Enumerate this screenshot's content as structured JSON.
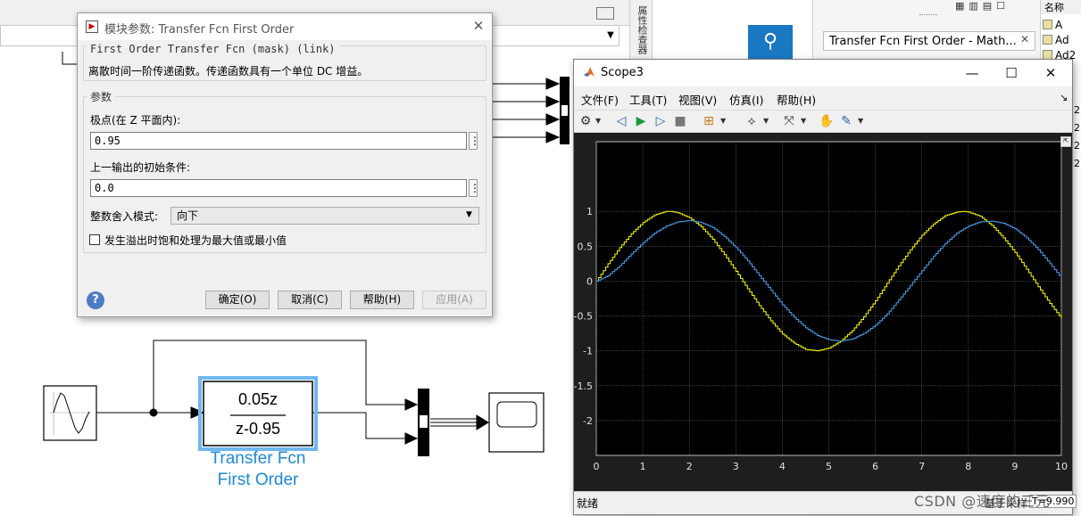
{
  "dialog": {
    "title": "模块参数: Transfer Fcn First Order",
    "mask_group": "First Order Transfer Fcn (mask) (link)",
    "mask_description": "离散时间一阶传递函数。传递函数具有一个单位 DC 增益。",
    "params_group": "参数",
    "pole_label": "极点(在 Z 平面内):",
    "pole_value": "0.95",
    "ic_label": "上一输出的初始条件:",
    "ic_value": "0.0",
    "round_label": "整数舍入模式:",
    "round_value": "向下",
    "saturate_label": "发生溢出时饱和处理为最大值或最小值",
    "saturate_checked": false,
    "buttons": {
      "ok": "确定(O)",
      "cancel": "取消(C)",
      "help": "帮助(H)",
      "apply": "应用(A)"
    },
    "help_icon": "?",
    "dots": "⋮"
  },
  "scope": {
    "title": "Scope3",
    "menu": [
      "文件(F)",
      "工具(T)",
      "视图(V)",
      "仿真(I)",
      "帮助(H)"
    ],
    "status": "就绪",
    "status_sample": "基于采样",
    "status_time": "T=9.990",
    "win_min": "—",
    "win_max": "☐",
    "win_close": "✕",
    "menu_arrow": "↘"
  },
  "side": {
    "property_tab": "属性检查器",
    "doc_tab": "Transfer Fcn First Order - Math...",
    "ws_header": "名称",
    "ws_items": [
      "A",
      "Ad",
      "Ad2"
    ],
    "ws_partial": [
      "2",
      "2",
      "2",
      "2"
    ]
  },
  "model": {
    "tf_numerator": "0.05z",
    "tf_denominator": "z-0.95",
    "tf_label_line1": "Transfer Fcn",
    "tf_label_line2": "First Order"
  },
  "watermark": "CSDN @速度的三元",
  "colors": {
    "input_series": "#ffff00",
    "output_series": "#4aa3ee",
    "tf_highlight": "#1e88d6",
    "plot_bg": "#000000"
  },
  "chart_data": {
    "type": "line",
    "title": "",
    "xlabel": "",
    "ylabel": "",
    "xlim": [
      0,
      10
    ],
    "ylim": [
      -2.5,
      2
    ],
    "xticks": [
      0,
      1,
      2,
      3,
      4,
      5,
      6,
      7,
      8,
      9,
      10
    ],
    "yticks": [
      -2,
      -1.5,
      -1,
      -0.5,
      0,
      0.5,
      1
    ],
    "ytick_labels": [
      "-2",
      "-1.5",
      "-1",
      "-0.5",
      "0",
      "0.5",
      "1"
    ],
    "grid": true,
    "sample_time": 0.05,
    "series": [
      {
        "color": "#ffff00",
        "x": [
          0,
          0.25,
          0.5,
          0.75,
          1.0,
          1.25,
          1.5,
          1.6,
          1.75,
          2.0,
          2.25,
          2.5,
          2.75,
          3.0,
          3.25,
          3.5,
          3.75,
          4.0,
          4.25,
          4.5,
          4.75,
          5.0,
          5.25,
          5.5,
          5.75,
          6.0,
          6.25,
          6.5,
          6.75,
          7.0,
          7.25,
          7.5,
          7.75,
          7.9,
          8.0,
          8.25,
          8.5,
          8.75,
          9.0,
          9.25,
          9.5,
          9.75,
          10.0
        ],
        "y": [
          0,
          0.25,
          0.48,
          0.68,
          0.84,
          0.95,
          1.0,
          1.0,
          0.98,
          0.91,
          0.78,
          0.6,
          0.38,
          0.14,
          -0.11,
          -0.35,
          -0.57,
          -0.76,
          -0.89,
          -0.98,
          -1.0,
          -0.96,
          -0.86,
          -0.71,
          -0.51,
          -0.28,
          -0.03,
          0.22,
          0.45,
          0.66,
          0.82,
          0.94,
          0.99,
          1.0,
          0.99,
          0.93,
          0.8,
          0.62,
          0.41,
          0.17,
          -0.08,
          -0.32,
          -0.54
        ]
      },
      {
        "color": "#4aa3ee",
        "x": [
          0,
          0.25,
          0.5,
          0.75,
          1.0,
          1.25,
          1.5,
          1.75,
          2.0,
          2.25,
          2.5,
          2.75,
          3.0,
          3.25,
          3.5,
          3.75,
          4.0,
          4.25,
          4.5,
          4.75,
          5.0,
          5.25,
          5.5,
          5.75,
          6.0,
          6.25,
          6.5,
          6.75,
          7.0,
          7.25,
          7.5,
          7.75,
          8.0,
          8.25,
          8.5,
          8.75,
          9.0,
          9.25,
          9.5,
          9.75,
          10.0
        ],
        "y": [
          0,
          0.08,
          0.22,
          0.39,
          0.55,
          0.69,
          0.79,
          0.85,
          0.87,
          0.84,
          0.77,
          0.64,
          0.48,
          0.29,
          0.08,
          -0.13,
          -0.34,
          -0.52,
          -0.67,
          -0.78,
          -0.84,
          -0.86,
          -0.83,
          -0.75,
          -0.63,
          -0.47,
          -0.27,
          -0.06,
          0.15,
          0.36,
          0.54,
          0.69,
          0.79,
          0.85,
          0.86,
          0.83,
          0.75,
          0.62,
          0.45,
          0.25,
          0.04
        ]
      }
    ]
  }
}
